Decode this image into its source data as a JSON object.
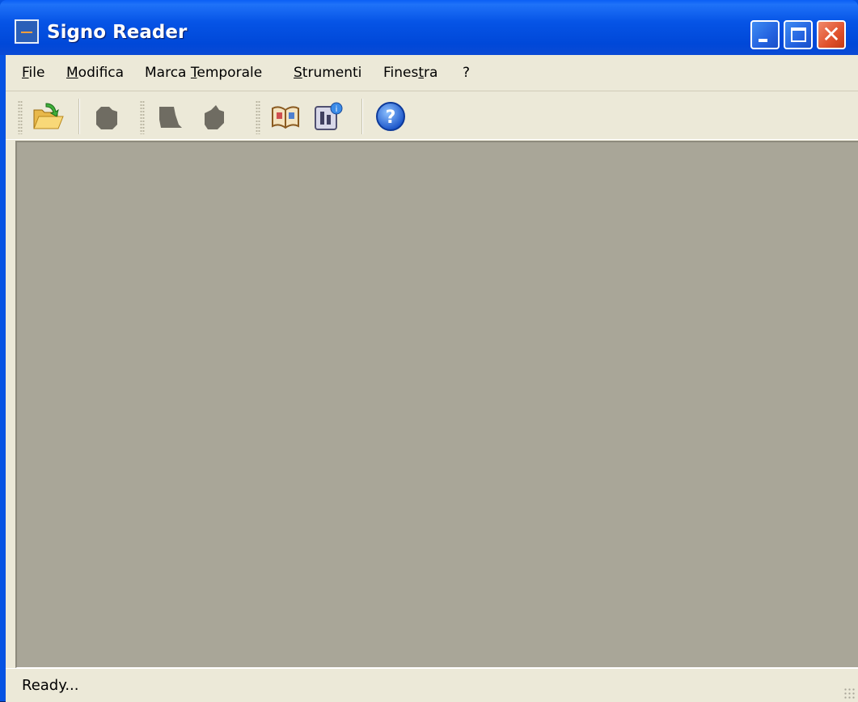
{
  "window": {
    "title": "Signo Reader",
    "close_glyph": "✕"
  },
  "menu": [
    {
      "label_pre": "",
      "label_ul": "F",
      "label_post": "ile"
    },
    {
      "label_pre": "",
      "label_ul": "M",
      "label_post": "odifica"
    },
    {
      "label_pre": "Marca ",
      "label_ul": "T",
      "label_post": "emporale"
    },
    {
      "label_pre": "",
      "label_ul": "S",
      "label_post": "trumenti"
    },
    {
      "label_pre": "Fines",
      "label_ul": "t",
      "label_post": "ra"
    },
    {
      "label_pre": "?",
      "label_ul": "",
      "label_post": ""
    }
  ],
  "toolbar": {
    "icons": [
      "open-folder-icon",
      "sign-icon",
      "verify-icon",
      "cosign-icon",
      "book-icon",
      "info-tools-icon",
      "help-icon"
    ],
    "help_glyph": "?"
  },
  "statusbar": {
    "text": "Ready..."
  },
  "colors": {
    "titlebar": "#0553e3",
    "workspace": "#a9a698",
    "chrome": "#ece9d8"
  }
}
